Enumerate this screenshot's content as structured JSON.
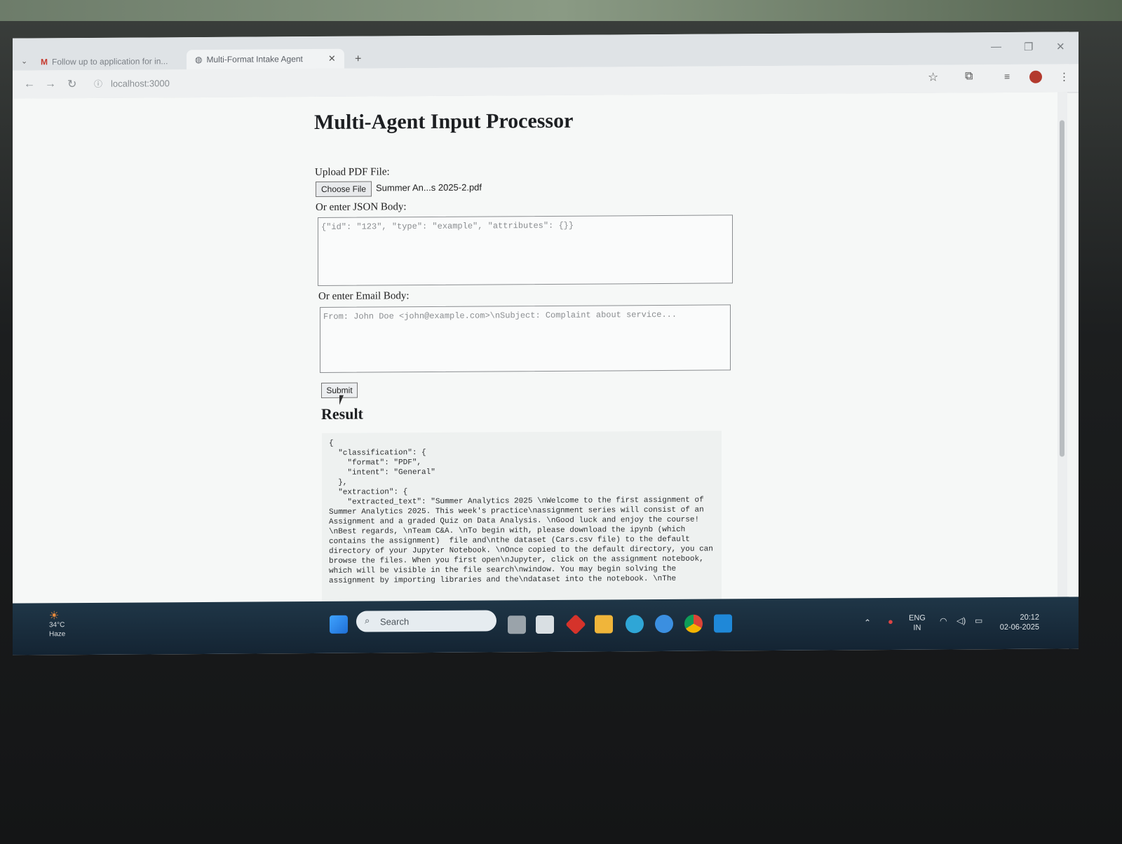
{
  "browser": {
    "tabs": [
      {
        "label": "Follow up to application for in..."
      },
      {
        "label": "Multi-Format Intake Agent"
      }
    ],
    "new_tab": "+",
    "url": "localhost:3000"
  },
  "page": {
    "title": "Multi-Agent Input Processor",
    "upload_label": "Upload PDF File:",
    "choose_file_button": "Choose File",
    "selected_file": "Summer An...s 2025-2.pdf",
    "json_label": "Or enter JSON Body:",
    "json_placeholder": "{\"id\": \"123\", \"type\": \"example\", \"attributes\": {}}",
    "email_label": "Or enter Email Body:",
    "email_placeholder": "From: John Doe <john@example.com>\\nSubject: Complaint about service...",
    "submit_button": "Submit",
    "result_heading": "Result",
    "result_text": "{\n  \"classification\": {\n    \"format\": \"PDF\",\n    \"intent\": \"General\"\n  },\n  \"extraction\": {\n    \"extracted_text\": \"Summer Analytics 2025 \\nWelcome to the first assignment of Summer Analytics 2025. This week's practice\\nassignment series will consist of an Assignment and a graded Quiz on Data Analysis. \\nGood luck and enjoy the course! \\nBest regards, \\nTeam C&A. \\nTo begin with, please download the ipynb (which contains the assignment)  file and\\nthe dataset (Cars.csv file) to the default directory of your Jupyter Notebook. \\nOnce copied to the default directory, you can browse the files. When you first open\\nJupyter, click on the assignment notebook, which will be visible in the file search\\nwindow. You may begin solving the assignment by importing libraries and the\\ndataset into the notebook. \\nThe"
  },
  "taskbar": {
    "weather_temp": "34°C",
    "weather_desc": "Haze",
    "search_label": "Search",
    "lang_top": "ENG",
    "lang_bottom": "IN",
    "time": "20:12",
    "date": "02-06-2025"
  }
}
